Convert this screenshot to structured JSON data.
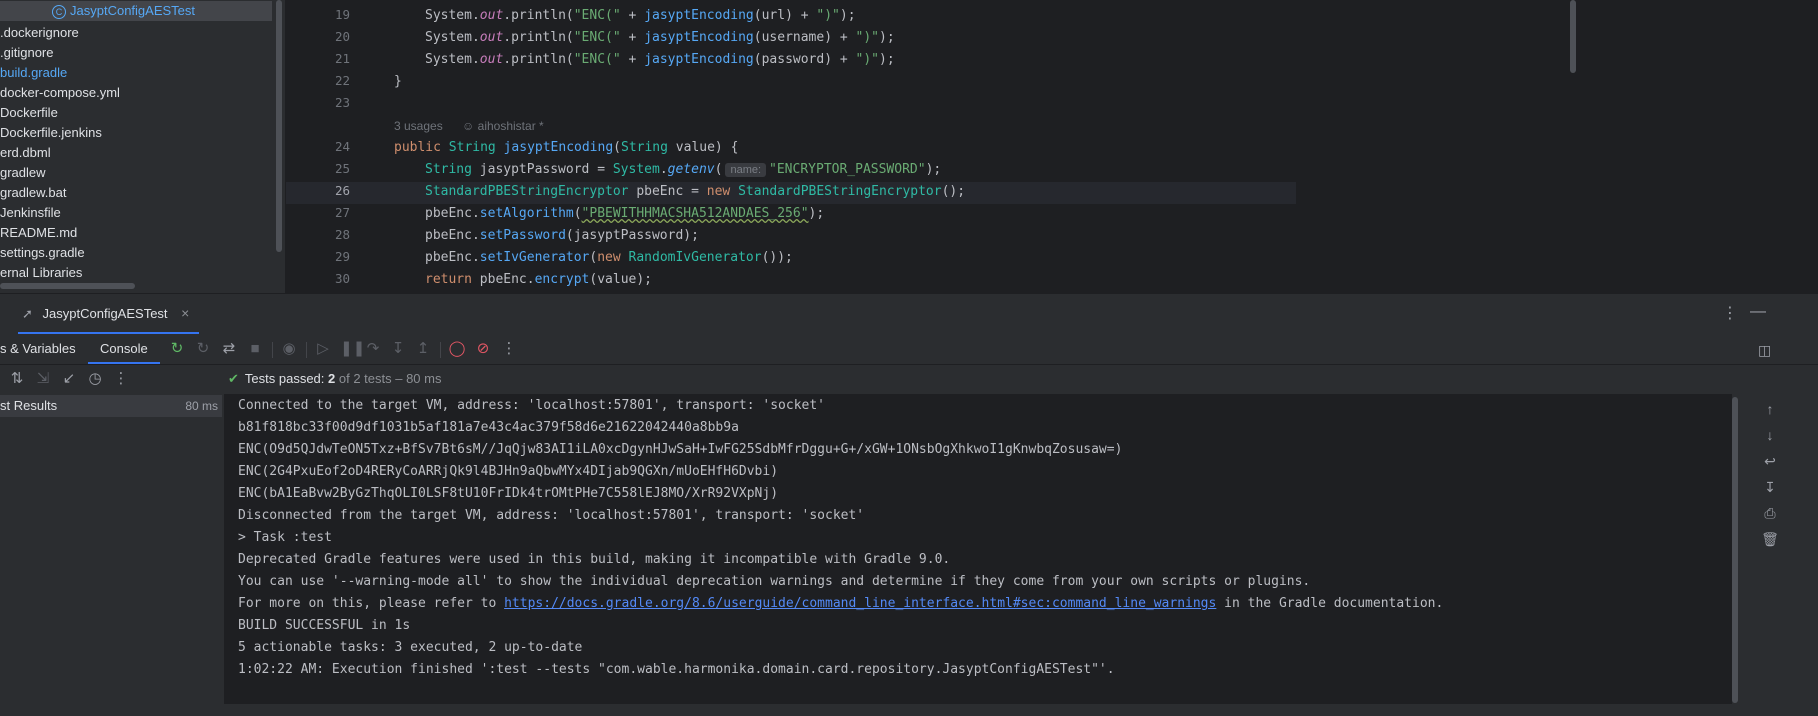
{
  "project_tree": {
    "items": [
      {
        "label": "JasyptConfigAESTest",
        "selected": true
      },
      {
        "label": ".dockerignore"
      },
      {
        "label": ".gitignore"
      },
      {
        "label": "build.gradle",
        "modified": true
      },
      {
        "label": "docker-compose.yml"
      },
      {
        "label": "Dockerfile"
      },
      {
        "label": "Dockerfile.jenkins"
      },
      {
        "label": "erd.dbml"
      },
      {
        "label": "gradlew"
      },
      {
        "label": "gradlew.bat"
      },
      {
        "label": "Jenkinsfile"
      },
      {
        "label": "README.md"
      },
      {
        "label": "settings.gradle"
      },
      {
        "label": "ernal Libraries"
      }
    ]
  },
  "editor": {
    "line_numbers": [
      "19",
      "20",
      "21",
      "22",
      "23",
      "24",
      "25",
      "26",
      "27",
      "28",
      "29",
      "30"
    ],
    "current_line": "26",
    "inlay_usages": "3 usages",
    "inlay_author": "aihoshistar *",
    "param_hint": "name:",
    "code": {
      "l19a": "System.",
      "l19b": "out",
      "l19c": ".println(",
      "l19d": "\"ENC(\"",
      "l19e": " + ",
      "l19f": "jasyptEncoding",
      "l19g": "(url) + ",
      "l19h": "\")\"",
      "l19i": ");",
      "l20a": "System.",
      "l20b": "out",
      "l20c": ".println(",
      "l20d": "\"ENC(\"",
      "l20e": " + ",
      "l20f": "jasyptEncoding",
      "l20g": "(username) + ",
      "l20h": "\")\"",
      "l20i": ");",
      "l21a": "System.",
      "l21b": "out",
      "l21c": ".println(",
      "l21d": "\"ENC(\"",
      "l21e": " + ",
      "l21f": "jasyptEncoding",
      "l21g": "(password) + ",
      "l21h": "\")\"",
      "l21i": ");",
      "l22": "}",
      "l24a": "public ",
      "l24b": "String ",
      "l24c": "jasyptEncoding",
      "l24d": "(",
      "l24e": "String",
      "l24f": " value) {",
      "l25a": "String",
      "l25b": " jasyptPassword = ",
      "l25c": "System",
      "l25d": ".",
      "l25e": "getenv",
      "l25f": "(",
      "l25g": "\"ENCRYPTOR_PASSWORD\"",
      "l25h": ");",
      "l26a": "StandardPBEStringEncryptor",
      "l26b": " pbeEnc = ",
      "l26c": "new ",
      "l26d": "StandardPBEStringEncryptor",
      "l26e": "();",
      "l27a": "pbeEnc.",
      "l27b": "setAlgorithm",
      "l27c": "(",
      "l27d": "\"PBEWITHHMACSHA512ANDAES_256\"",
      "l27e": ");",
      "l28a": "pbeEnc.",
      "l28b": "setPassword",
      "l28c": "(jasyptPassword);",
      "l29a": "pbeEnc.",
      "l29b": "setIvGenerator",
      "l29c": "(",
      "l29d": "new ",
      "l29e": "RandomIvGenerator",
      "l29f": "());",
      "l30a": "return ",
      "l30b": "pbeEnc.",
      "l30c": "encrypt",
      "l30d": "(value);"
    }
  },
  "run_window": {
    "tab_label": "JasyptConfigAESTest",
    "subtab_variables": "s & Variables",
    "subtab_console": "Console",
    "tests_status_label": "Tests passed: ",
    "tests_passed": "2",
    "tests_detail": " of 2 tests – 80 ms",
    "test_root": {
      "label": "st Results",
      "duration": "80 ms"
    },
    "console_lines": [
      "Connected to the target VM, address: 'localhost:57801', transport: 'socket'",
      "b81f818bc33f00d9df1031b5af181a7e43c4ac379f58d6e21622042440a8bb9a",
      "ENC(O9d5QJdwTeON5Txz+BfSv7Bt6sM//JqQjw83AI1iLA0xcDgynHJwSaH+IwFG25SdbMfrDggu+G+/xGW+1ONsbOgXhkwoI1gKnwbqZosusaw=)",
      "ENC(2G4PxuEof2oD4RERyCoARRjQk9l4BJHn9aQbwMYx4DIjab9QGXn/mUoEHfH6Dvbi)",
      "ENC(bA1EaBvw2ByGzThqOLI0LSF8tU10FrIDk4trOMtPHe7C558lEJ8MO/XrR92VXpNj)",
      "Disconnected from the target VM, address: 'localhost:57801', transport: 'socket'",
      "> Task :test",
      "Deprecated Gradle features were used in this build, making it incompatible with Gradle 9.0.",
      "You can use '--warning-mode all' to show the individual deprecation warnings and determine if they come from your own scripts or plugins.",
      "For more on this, please refer to ",
      "BUILD SUCCESSFUL in 1s",
      "5 actionable tasks: 3 executed, 2 up-to-date",
      "1:02:22 AM: Execution finished ':test --tests \"com.wable.harmonika.domain.card.repository.JasyptConfigAESTest\"'."
    ],
    "docs_link": "https://docs.gradle.org/8.6/userguide/command_line_interface.html#sec:command_line_warnings",
    "docs_suffix": " in the Gradle documentation."
  },
  "colors": {
    "accent": "#3574f0",
    "success": "#5fb865",
    "link": "#548af7"
  }
}
